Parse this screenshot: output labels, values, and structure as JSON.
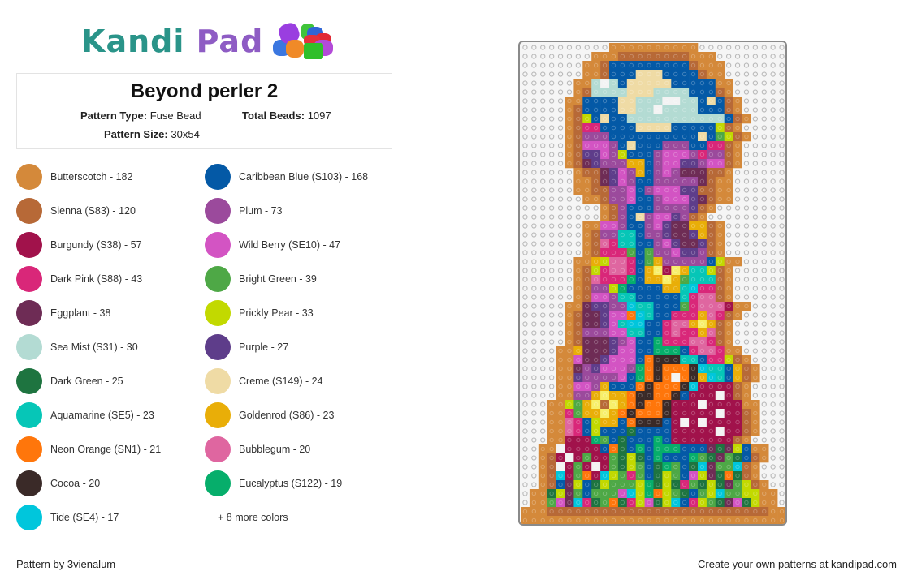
{
  "brand": {
    "name_part1": "Kandi",
    "name_part2": " Pad",
    "logo_icon": "bead-pile-icon"
  },
  "pattern": {
    "title": "Beyond perler 2",
    "type_label": "Pattern Type:",
    "type_value": "Fuse Bead",
    "beads_label": "Total Beads:",
    "beads_value": "1097",
    "size_label": "Pattern Size:",
    "size_value": "30x54"
  },
  "legend": [
    {
      "label": "Butterscotch - 182",
      "color": "#d4893a"
    },
    {
      "label": "Caribbean Blue (S103) - 168",
      "color": "#0459a6"
    },
    {
      "label": "Sienna (S83) - 120",
      "color": "#b76937"
    },
    {
      "label": "Plum - 73",
      "color": "#9b4a9c"
    },
    {
      "label": "Burgundy (S38) - 57",
      "color": "#a1124b"
    },
    {
      "label": "Wild Berry (SE10) - 47",
      "color": "#d354c3"
    },
    {
      "label": "Dark Pink (S88) - 43",
      "color": "#d92779"
    },
    {
      "label": "Bright Green - 39",
      "color": "#4ea846"
    },
    {
      "label": "Eggplant - 38",
      "color": "#6e2c55"
    },
    {
      "label": "Prickly Pear - 33",
      "color": "#c2d900"
    },
    {
      "label": "Sea Mist (S31) - 30",
      "color": "#b3dbd3"
    },
    {
      "label": "Purple - 27",
      "color": "#5e3d8a"
    },
    {
      "label": "Dark Green - 25",
      "color": "#1e7440"
    },
    {
      "label": "Creme (S149) - 24",
      "color": "#efdba5"
    },
    {
      "label": "Aquamarine (SE5) - 23",
      "color": "#06c6b7"
    },
    {
      "label": "Goldenrod (S86) - 23",
      "color": "#e9ae08"
    },
    {
      "label": "Neon Orange (SN1) - 21",
      "color": "#ff760b"
    },
    {
      "label": "Bubblegum - 20",
      "color": "#df66a0"
    },
    {
      "label": "Cocoa - 20",
      "color": "#3a2a28"
    },
    {
      "label": "Eucalyptus (S122) - 19",
      "color": "#06ae6b"
    },
    {
      "label": "Tide (SE4) - 17",
      "color": "#00c6dc"
    }
  ],
  "more_colors": "+ 8 more colors",
  "footer": {
    "left": "Pattern by 3vienalum",
    "right": "Create your own patterns at kandipad.com"
  },
  "board": {
    "columns": 30,
    "rows": 54,
    "palette": {
      "B": "#d4893a",
      "S": "#b76937",
      "C": "#0459a6",
      "M": "#b3dbd3",
      "E": "#efdba5",
      "W": "#f3f3f3",
      "P": "#9b4a9c",
      "R": "#d354c3",
      "K": "#d92779",
      "G": "#4ea846",
      "Y": "#c2d900",
      "U": "#5e3d8a",
      "X": "#6e2c55",
      "D": "#1e7440",
      "A": "#06c6b7",
      "O": "#e9ae08",
      "N": "#ff760b",
      "Q": "#df66a0",
      "T": "#3a2a28",
      "L": "#06ae6b",
      "I": "#00c6dc",
      "Z": "#a1124b",
      "V": "#f7ef6a"
    },
    "cells": [
      "..........BBBBBBBBBB..........",
      "........BBBSSSSSSSSBBB........",
      ".......BBSCCCCCCCCCSBBB.......",
      ".......BBSCCCEEECCCCSBB.......",
      "......BBMWMCEEEEECCCCCBB......",
      "......BSMMMMEEEMMMMCCCSB......",
      ".....BBCCCCEEMMMWWMMCECSB.....",
      ".....BSCCCCEEMMWMMMMCCCSB.....",
      ".....BSYCECCMMMMMMMMMMMCSB....",
      ".....BSKKCCCCEEEECCCCCYSB.....",
      ".....BSPPPCCCCCCCCCCECGYSB....",
      ".....BSRRRPCECCCPPPCCKKSB.....",
      ".....BSUURPYCCCPRRRPKPPSB.....",
      ".....BSXUPPPOOCPRRUUPRRSB.....",
      "......BSSXURPOCPRPXXXSSB......",
      "......BBSXURPCCPPPPPXSBB......",
      "......BBSSPPRCPRRRUUSSBB......",
      ".......BBSPPRCCPRRRUXSBB......",
      ".........BSPCCCPPPPUSB........",
      ".........BSPCEPRRUPSB.........",
      ".......BBRRPCCPRUXXOOSB.......",
      ".......BSPPAACPPUXXUOSB.......",
      ".......BSQKAACCPRUXXUSB.......",
      ".......BSKKKGCGPPRUUPSB.......",
      "......BBOYQQKCGOPPPPPCYBB.....",
      "......BSYKQQKCOVZVOAAYSB......",
      "......BSQKKKLCOOVOGAAASB......",
      "......BSPPYLCCCCOOAIKKSB......",
      "......BSRRPAACCCCCAKQQSB......",
      ".....BBXUUPPIAACCCGKQQQZBB....",
      ".....BSXXURRNIACCKKKOQKSB.....",
      ".....BSXXURAIICCKQQOVOSB......",
      ".....BSPPPRRAACCKQKKOQSB......",
      ".....BSXXXUPRCCLKKKQQKSB......",
      "....BBOXXXURRCCLLLCKQQKBB.....",
      "....BBRXXURRRCNTTTAACKKYSB....",
      "....BBXPURRRPLNTNNNTIAACOSB...",
      "....BBUPPPPRCLNTNWNTOIACOSB...",
      "....BBRRPOCCCNTNNNTIZZZZSB....",
      "....BBPPOVOONTTNNTCZZZWZSB....",
      "...BBYGOVSVONTNNTZZZWZZZZBB...",
      "...BBKGOOVONTNNNTZZZZZWZZSB...",
      "...BBQKCYOOCNTTTCZWZWZZZZSB...",
      "...BBQKCYCCCDCCCCZZZZZWZZSB...",
      "...BBZZZLGCDCCCLCZZZZZZZSB....",
      "..BBWZZZZCNDCLCLLLCCCXDXYCBB..",
      "..BSZWZGZZGDYDCLCCCLGDXGDCSB..",
      "..BSWZGZWZGDYGCDLGCDIXGGISB...",
      "..BSIZGNZIYGKGCDYGCRYXDNDSB...",
      "..BSCXYCDYGGGYLDYDKGDYDXGYSB..",
      ".BBDYXGCGGGRIYLNYGDCGYIGGYYBB.",
      ".BBGRXIKDGNDKYRDYICKYGDXRDYBB.",
      "BBBSSSSSSSSSSSSSSSSSSSSSSSSSBB",
      "BBBBBBBBBBBBBBBBBBBBBBBBBBBBBB"
    ]
  }
}
